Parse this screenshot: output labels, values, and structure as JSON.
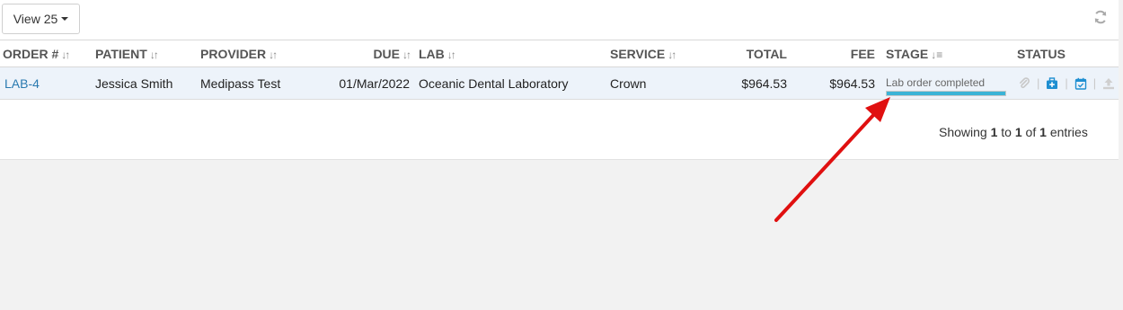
{
  "toolbar": {
    "view_label": "View 25"
  },
  "table": {
    "headers": {
      "order": "ORDER #",
      "patient": "PATIENT",
      "provider": "PROVIDER",
      "due": "DUE",
      "lab": "LAB",
      "service": "SERVICE",
      "total": "TOTAL",
      "fee": "FEE",
      "stage": "STAGE",
      "status": "STATUS"
    },
    "rows": [
      {
        "order": "LAB-4",
        "patient": "Jessica Smith",
        "provider": "Medipass Test",
        "due": "01/Mar/2022",
        "lab": "Oceanic Dental Laboratory",
        "service": "Crown",
        "total": "$964.53",
        "fee": "$964.53",
        "stage": "Lab order completed",
        "stage_progress_pct": 100
      }
    ]
  },
  "footer": {
    "showing": "Showing",
    "from": "1",
    "to_word": "to",
    "to": "1",
    "of_word": "of",
    "total": "1",
    "entries": "entries"
  },
  "colors": {
    "link": "#2a7ab0",
    "row_highlight": "#edf3fa",
    "progress_fill": "#3bb3d6",
    "annotation_arrow": "#e01010",
    "status_icon_active": "#1f8fd1",
    "status_icon_inactive": "#c8c8c8"
  },
  "icons": {
    "refresh": "refresh-icon",
    "status": [
      "paperclip-icon",
      "briefcase-medical-icon",
      "calendar-check-icon",
      "upload-icon"
    ]
  }
}
